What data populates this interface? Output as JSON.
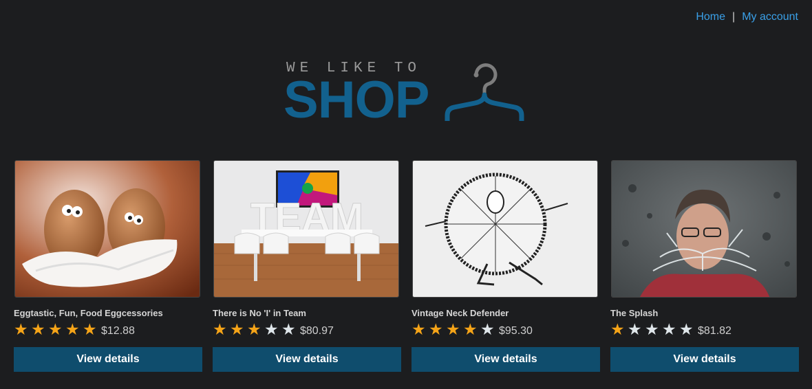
{
  "nav": {
    "home": "Home",
    "separator": "|",
    "account": "My account"
  },
  "logo": {
    "tagline": "WE LIKE TO",
    "brand": "SHOP",
    "icon": "hanger-icon",
    "brand_color": "#12618e"
  },
  "colors": {
    "star_on": "#f5a418",
    "star_off": "#dfe6ea",
    "button": "#0f4d6d",
    "link": "#3aa0e8"
  },
  "products": [
    {
      "title": "Eggtastic, Fun, Food Eggcessories",
      "rating": 5,
      "price": "$12.88",
      "button": "View details",
      "image": "eggs-on-feathers"
    },
    {
      "title": "There is No 'I' in Team",
      "rating": 3,
      "price": "$80.97",
      "button": "View details",
      "image": "team-letters-meeting-room"
    },
    {
      "title": "Vintage Neck Defender",
      "rating": 4,
      "price": "$95.30",
      "button": "View details",
      "image": "vintage-collar-drawing"
    },
    {
      "title": "The Splash",
      "rating": 1,
      "price": "$81.82",
      "button": "View details",
      "image": "woman-water-splash"
    }
  ]
}
